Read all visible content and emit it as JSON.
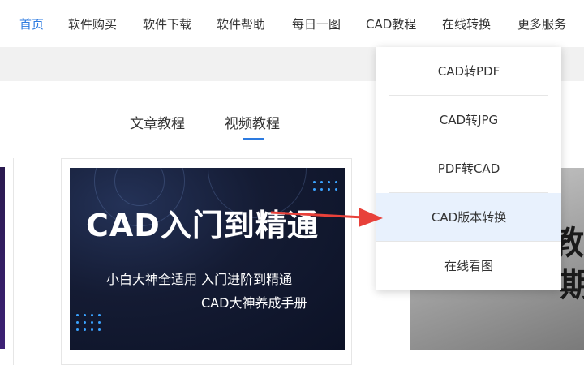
{
  "nav": {
    "items": [
      {
        "label": "首页",
        "active": true
      },
      {
        "label": "软件购买"
      },
      {
        "label": "软件下载"
      },
      {
        "label": "软件帮助"
      },
      {
        "label": "每日一图"
      },
      {
        "label": "CAD教程"
      },
      {
        "label": "在线转换"
      },
      {
        "label": "更多服务"
      }
    ],
    "accent_color": "#2d7be0"
  },
  "tabs": [
    {
      "label": "文章教程"
    },
    {
      "label": "视频教程",
      "active": true
    }
  ],
  "card": {
    "title": "CAD入门到精通",
    "subtitle": "小白大神全适用 入门进阶到精通",
    "subtitle2": "CAD大神养成手册"
  },
  "right_card": {
    "text1": "教程",
    "text2": "期你"
  },
  "dropdown": {
    "items": [
      {
        "label": "CAD转PDF"
      },
      {
        "label": "CAD转JPG"
      },
      {
        "label": "PDF转CAD"
      },
      {
        "label": "CAD版本转换",
        "highlighted": true
      },
      {
        "label": "在线看图"
      }
    ],
    "highlight_color": "#e8f1fd"
  },
  "annotation": {
    "arrow_color": "#e8413a",
    "arrow_icon": "red-arrow-icon"
  }
}
